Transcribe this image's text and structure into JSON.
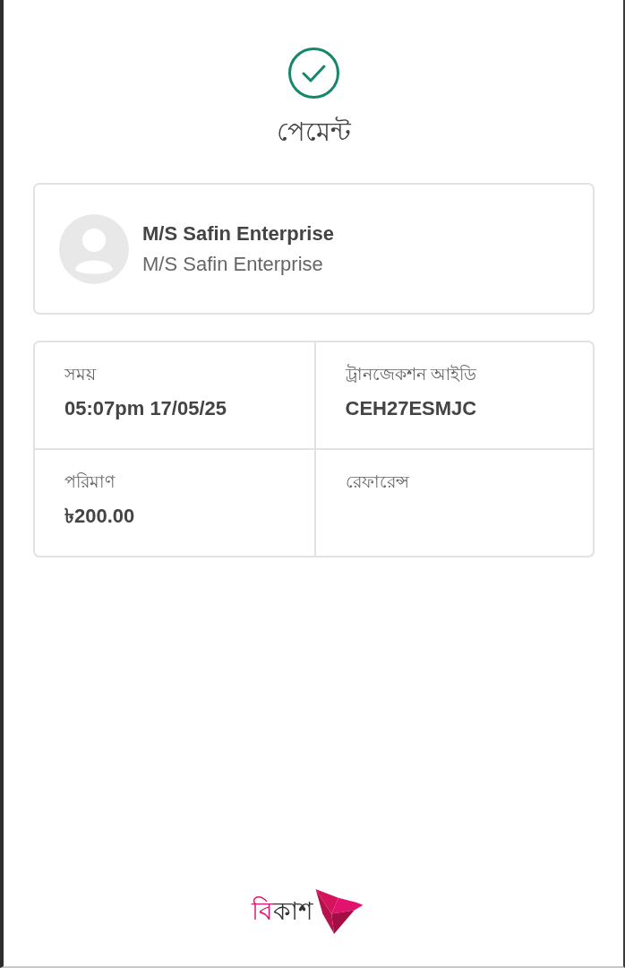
{
  "status": {
    "title": "পেমেন্ট"
  },
  "merchant": {
    "name": "M/S Safin Enterprise",
    "subtitle": "M/S Safin Enterprise"
  },
  "details": [
    {
      "label": "সময়",
      "value": "05:07pm 17/05/25"
    },
    {
      "label": "ট্রানজেকশন আইডি",
      "value": "CEH27ESMJC"
    },
    {
      "label": "পরিমাণ",
      "value": "৳200.00"
    },
    {
      "label": "রেফারেন্স"
    }
  ],
  "footer": {
    "logo_text": [
      "বি",
      "কাশ"
    ]
  }
}
